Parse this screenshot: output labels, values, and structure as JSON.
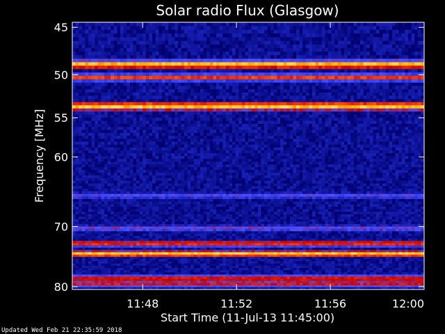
{
  "chart_data": {
    "type": "heatmap",
    "title": "Solar radio Flux (Glasgow)",
    "xlabel": "Start Time (11-Jul-13 11:45:00)",
    "ylabel": "Frequency [MHz]",
    "x_range": [
      "11:45",
      "12:00"
    ],
    "y_range_mhz": [
      80.5,
      44.5
    ],
    "y_scale": "log",
    "x_ticks": [
      "11:48",
      "11:52",
      "11:56",
      "12:00"
    ],
    "y_ticks": [
      "45",
      "50",
      "55",
      "60",
      "70",
      "80"
    ],
    "colormap": [
      "#000000",
      "#00006e",
      "#1e28c8",
      "#5050ff",
      "#c80000",
      "#ff3c00",
      "#ffb400",
      "#ffff96"
    ],
    "background_level": 0.2,
    "bands": [
      {
        "freq_mhz": 45.6,
        "intensity": 0.05,
        "width_mhz": 0.3
      },
      {
        "freq_mhz": 48.9,
        "intensity": 0.98,
        "width_mhz": 0.5
      },
      {
        "freq_mhz": 50.3,
        "intensity": 0.7,
        "width_mhz": 0.5
      },
      {
        "freq_mhz": 53.6,
        "intensity": 0.98,
        "width_mhz": 0.6
      },
      {
        "freq_mhz": 65.4,
        "intensity": 0.45,
        "width_mhz": 0.6
      },
      {
        "freq_mhz": 70.3,
        "intensity": 0.5,
        "width_mhz": 0.6
      },
      {
        "freq_mhz": 72.7,
        "intensity": 0.75,
        "width_mhz": 0.6
      },
      {
        "freq_mhz": 74.4,
        "intensity": 0.99,
        "width_mhz": 0.6
      },
      {
        "freq_mhz": 78.6,
        "intensity": 0.7,
        "width_mhz": 0.8
      },
      {
        "freq_mhz": 79.5,
        "intensity": 0.65,
        "width_mhz": 0.8
      }
    ]
  },
  "footer": {
    "updated": "Updated Wed Feb 21 22:35:59 2018"
  }
}
